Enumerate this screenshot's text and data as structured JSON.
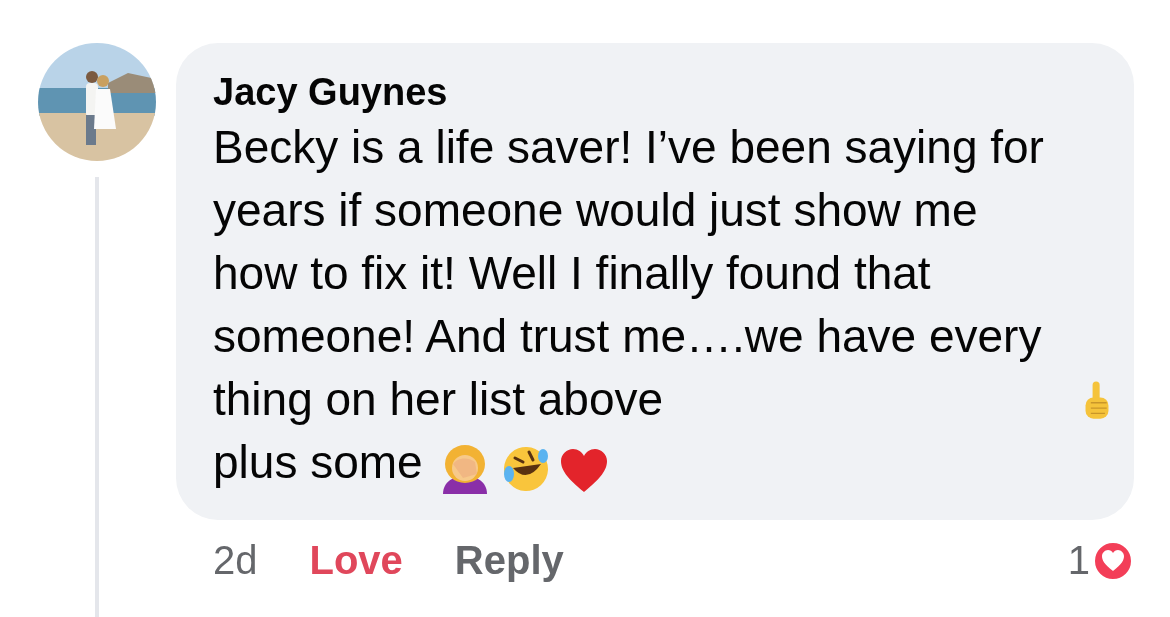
{
  "comment": {
    "author": "Jacy Guynes",
    "body": [
      {
        "kind": "text",
        "text": "Becky is a life saver! I’ve been saying for years if someone would just show me how to fix it! Well I finally found that someone! And trust me….we have every thing on her list above"
      },
      {
        "kind": "pointup"
      },
      {
        "kind": "text",
        "text": "plus some"
      },
      {
        "kind": "facepalm"
      },
      {
        "kind": "laughing"
      },
      {
        "kind": "heart"
      }
    ],
    "time": "2d",
    "love": {
      "label": "Love",
      "selected": true
    },
    "reply": "Reply",
    "reaction_count": "1"
  }
}
